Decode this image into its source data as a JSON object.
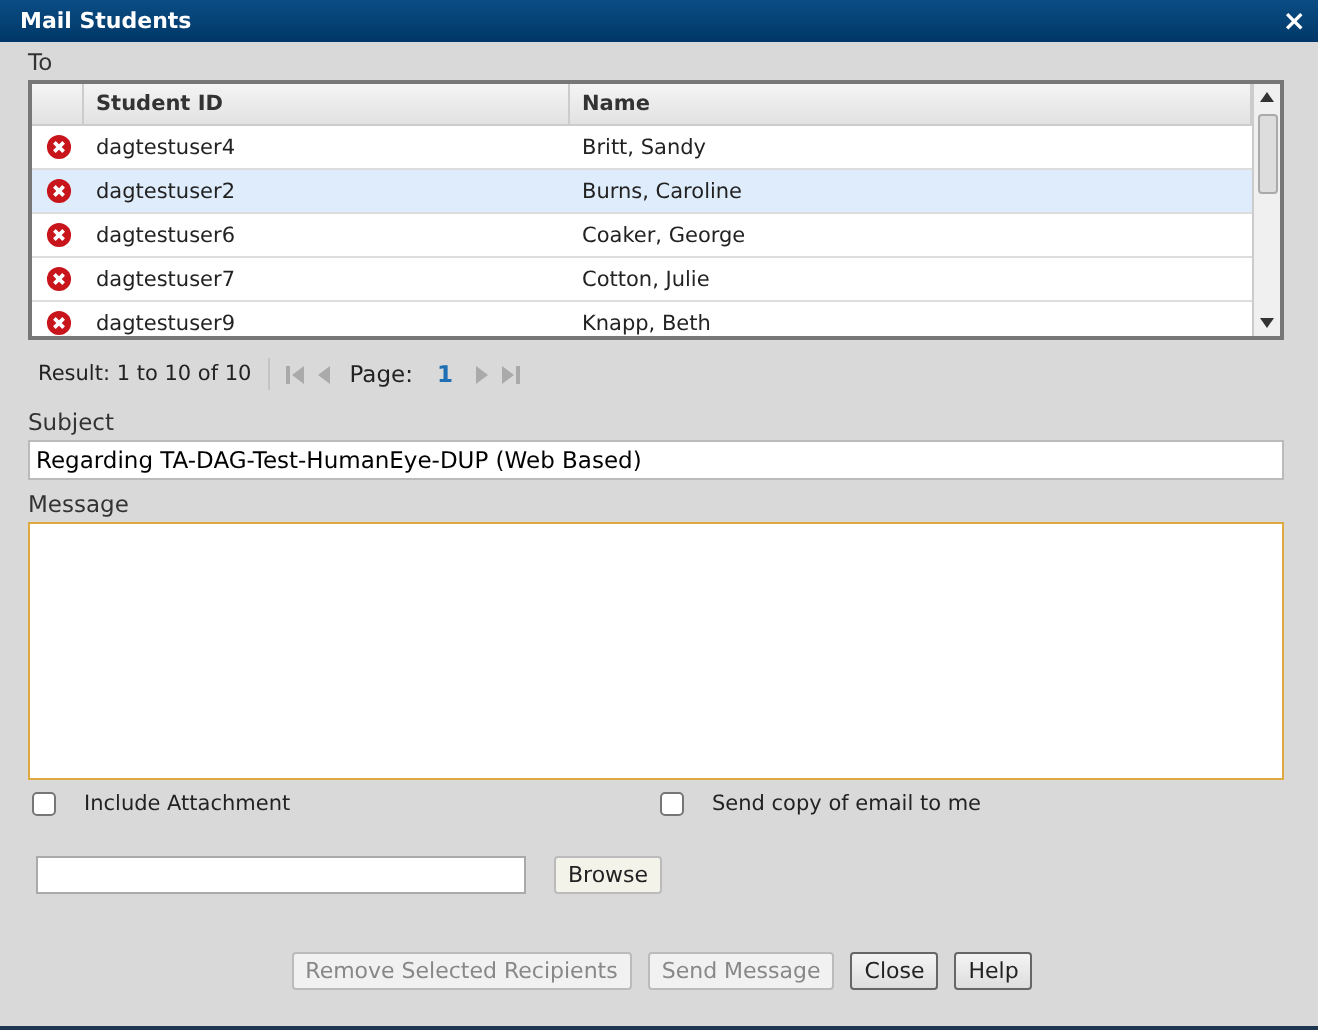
{
  "window": {
    "title": "Mail Students",
    "close": "×"
  },
  "to_label": "To",
  "table": {
    "columns": [
      "Student ID",
      "Name"
    ],
    "rows": [
      {
        "student_id": "dagtestuser4",
        "name": "Britt, Sandy",
        "selected": false
      },
      {
        "student_id": "dagtestuser2",
        "name": "Burns, Caroline",
        "selected": true
      },
      {
        "student_id": "dagtestuser6",
        "name": "Coaker, George",
        "selected": false
      },
      {
        "student_id": "dagtestuser7",
        "name": "Cotton, Julie",
        "selected": false
      },
      {
        "student_id": "dagtestuser9",
        "name": "Knapp, Beth",
        "selected": false
      }
    ]
  },
  "pager": {
    "result": "Result: 1 to 10 of 10",
    "page_label": "Page:",
    "page": "1"
  },
  "subject": {
    "label": "Subject",
    "value": "Regarding TA-DAG-Test-HumanEye-DUP (Web Based)"
  },
  "message": {
    "label": "Message"
  },
  "options": [
    {
      "label": "Include Attachment",
      "checked": false
    },
    {
      "label": "Send copy of email to me",
      "checked": false
    }
  ],
  "browse_button": "Browse",
  "buttons": [
    {
      "label": "Remove Selected Recipients",
      "disabled": true
    },
    {
      "label": "Send Message",
      "disabled": true
    },
    {
      "label": "Close",
      "disabled": false
    },
    {
      "label": "Help",
      "disabled": false
    }
  ]
}
